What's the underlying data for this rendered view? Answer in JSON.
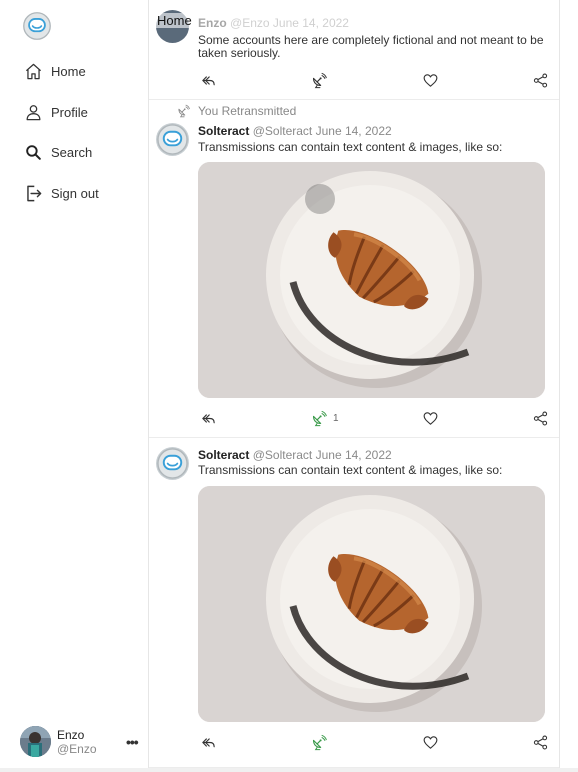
{
  "sidebar": {
    "logo": "astronaut-helmet-logo",
    "nav": [
      {
        "label": "Home",
        "icon": "home-icon"
      },
      {
        "label": "Profile",
        "icon": "user-icon"
      },
      {
        "label": "Search",
        "icon": "search-icon"
      },
      {
        "label": "Sign out",
        "icon": "sign-out-icon"
      }
    ],
    "user": {
      "name": "Enzo",
      "handle": "@Enzo",
      "more": "•••"
    }
  },
  "feed": {
    "header": "Home",
    "posts": [
      {
        "name": "Enzo",
        "handle": "@Enzo",
        "date": "June 14, 2022",
        "text": "Some accounts here are completely fictional and not meant to be taken seriously.",
        "retransmit_count": "",
        "retransmitted": false
      },
      {
        "retransmitted_by": "You Retransmitted",
        "name": "Solteract",
        "handle": "@Solteract",
        "date": "June 14, 2022",
        "text": "Transmissions can contain text content & images, like so:",
        "image": "croissant-on-plate-photo",
        "retransmit_count": "1",
        "retransmitted": true
      },
      {
        "name": "Solteract",
        "handle": "@Solteract",
        "date": "June 14, 2022",
        "text": "Transmissions can contain text content & images, like so:",
        "image": "croissant-on-plate-photo",
        "retransmit_count": "",
        "retransmitted": true
      }
    ]
  },
  "colors": {
    "accent_green": "#3a9a4a",
    "helmet_blue": "#3aa0d8",
    "border": "#e6e6e6"
  }
}
